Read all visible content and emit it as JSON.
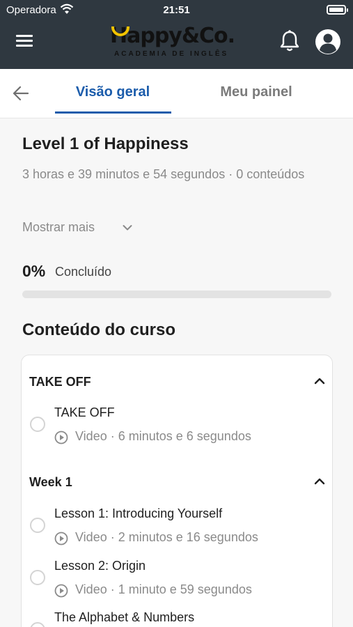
{
  "status_bar": {
    "carrier": "Operadora",
    "time": "21:51"
  },
  "header": {
    "logo_main": "Happy&Co.",
    "logo_sub": "ACADEMIA DE INGLÊS",
    "icons": {
      "menu": "hamburger-icon",
      "notifications": "bell-icon",
      "profile": "user-circle-icon"
    }
  },
  "tabs": {
    "back_icon": "arrow-left-icon",
    "items": [
      {
        "label": "Visão geral",
        "active": true
      },
      {
        "label": "Meu painel",
        "active": false
      }
    ]
  },
  "course": {
    "title": "Level 1 of Happiness",
    "meta": "3 horas e 39 minutos e 54 segundos · 0 conteúdos",
    "show_more": "Mostrar mais",
    "progress_percent": "0%",
    "progress_value": 0,
    "progress_label": "Concluído"
  },
  "content": {
    "heading": "Conteúdo do curso",
    "modules": [
      {
        "title": "TAKE OFF",
        "items": [
          {
            "title": "TAKE OFF",
            "meta": "Video · 6 minutos e 6 segundos"
          }
        ]
      },
      {
        "title": "Week 1",
        "items": [
          {
            "title": "Lesson 1: Introducing Yourself",
            "meta": "Video · 2 minutos e 16 segundos"
          },
          {
            "title": "Lesson 2: Origin",
            "meta": "Video · 1 minuto e 59 segundos"
          },
          {
            "title": "The Alphabet & Numbers",
            "meta": ""
          }
        ]
      }
    ]
  },
  "colors": {
    "header_bg": "#2f3840",
    "accent": "#1b5cab",
    "brand_yellow": "#f2c300"
  }
}
